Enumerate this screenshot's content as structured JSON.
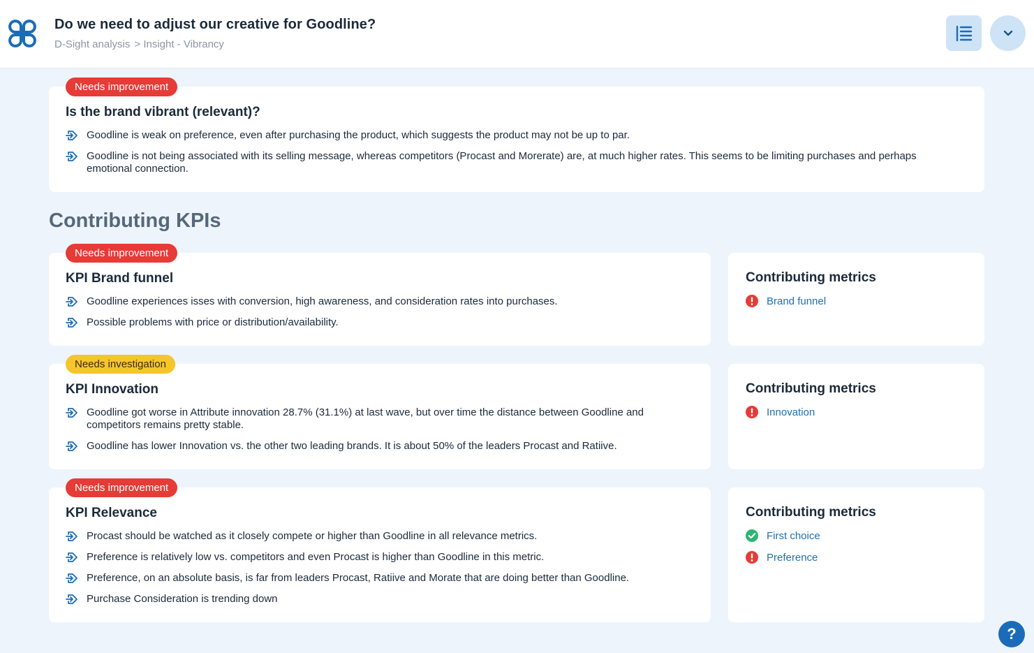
{
  "header": {
    "title": "Do we need to adjust our creative for Goodline?",
    "breadcrumb": [
      "D-Sight analysis",
      "> Insight - Vibrancy"
    ]
  },
  "icons": {
    "logo": "app-logo-icon",
    "toc": "list-icon",
    "dropdown": "chevron-down-icon",
    "bullet": "arrow-right-icon",
    "bad_status": "exclamation-icon",
    "good_status": "check-icon",
    "help": "question-icon"
  },
  "colors": {
    "needs_improvement": "#e63b36",
    "needs_investigation": "#f5c52a",
    "good": "#2bb673",
    "link": "#1f6fb2",
    "accent": "#1a6cb8"
  },
  "summary": {
    "status": "Needs improvement",
    "heading": "Is the brand vibrant (relevant)?",
    "bullets": [
      "Goodline is weak on preference, even after purchasing the product, which suggests the product may not be up to par.",
      "Goodline is not being associated with its selling message, whereas competitors (Procast and Morerate) are, at much higher rates. This seems to be limiting purchases and perhaps emotional connection."
    ]
  },
  "section_title": "Contributing KPIs",
  "kpis": [
    {
      "status": "Needs improvement",
      "title": "KPI Brand funnel",
      "bullets": [
        "Goodline experiences isses with conversion, high awareness, and consideration rates into purchases.",
        "Possible problems with price or distribution/availability."
      ],
      "metrics_title": "Contributing metrics",
      "metrics": [
        {
          "label": "Brand funnel",
          "status": "bad"
        }
      ]
    },
    {
      "status": "Needs investigation",
      "title": "KPI Innovation",
      "bullets": [
        "Goodline got worse in Attribute  innovation 28.7% (31.1%) at last wave, but over time the distance between Goodline and competitors remains pretty stable.",
        "Goodline has lower Innovation vs. the other two leading brands. It is about 50% of the leaders Procast and Ratiive."
      ],
      "metrics_title": "Contributing metrics",
      "metrics": [
        {
          "label": "Innovation",
          "status": "bad"
        }
      ]
    },
    {
      "status": "Needs improvement",
      "title": "KPI Relevance",
      "bullets": [
        "Procast should be watched as it closely compete or higher than Goodline in all relevance metrics.",
        "Preference is relatively low vs. competitors and even Procast is higher than Goodline in this metric.",
        "Preference, on an absolute basis, is far from leaders Procast, Ratiive and Morate that are doing better than Goodline.",
        "Purchase Consideration is trending down"
      ],
      "metrics_title": "Contributing metrics",
      "metrics": [
        {
          "label": "First choice",
          "status": "good"
        },
        {
          "label": "Preference",
          "status": "bad"
        }
      ]
    }
  ],
  "help_label": "?"
}
